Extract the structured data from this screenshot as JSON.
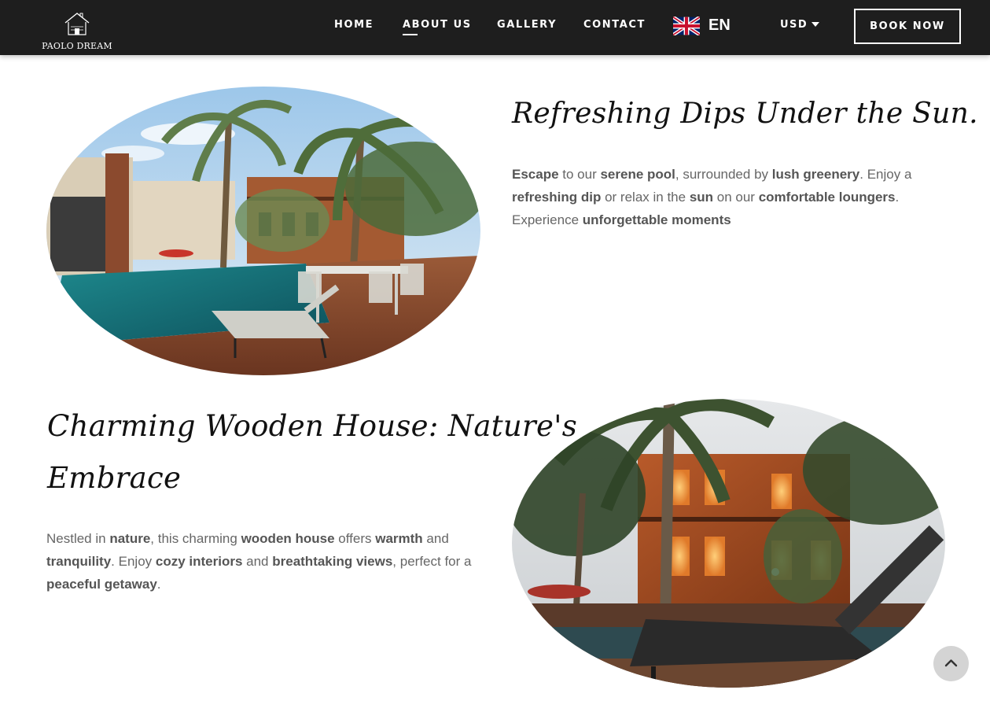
{
  "header": {
    "logo_text": "PAOLO DREAM",
    "nav": [
      {
        "label": "HOME"
      },
      {
        "label": "ABOUT US",
        "active": true
      },
      {
        "label": "GALLERY"
      },
      {
        "label": "CONTACT"
      }
    ],
    "language": {
      "label": "EN",
      "flag_icon": "uk-flag-icon"
    },
    "currency": {
      "label": "USD",
      "icon": "caret-down-icon"
    },
    "book_button": "BOOK NOW"
  },
  "section_pool": {
    "title": "Refreshing Dips Under the Sun.",
    "text": [
      {
        "t": "Escape",
        "b": true
      },
      {
        "t": " to our ",
        "b": false
      },
      {
        "t": "serene pool",
        "b": true
      },
      {
        "t": ", surrounded by ",
        "b": false
      },
      {
        "t": "lush greenery",
        "b": true
      },
      {
        "t": ". Enjoy a ",
        "b": false
      },
      {
        "t": "refreshing dip",
        "b": true
      },
      {
        "t": " or relax in the ",
        "b": false
      },
      {
        "t": "sun",
        "b": true
      },
      {
        "t": " on our ",
        "b": false
      },
      {
        "t": "comfortable loungers",
        "b": true
      },
      {
        "t": ". Experience ",
        "b": false
      },
      {
        "t": "unforgettable moments",
        "b": true
      }
    ]
  },
  "section_house": {
    "title_line1": "Charming Wooden House: Nature's",
    "title_line2": "Embrace",
    "text": [
      {
        "t": "Nestled in ",
        "b": false
      },
      {
        "t": "nature",
        "b": true
      },
      {
        "t": ", this charming ",
        "b": false
      },
      {
        "t": "wooden house",
        "b": true
      },
      {
        "t": " offers ",
        "b": false
      },
      {
        "t": "warmth",
        "b": true
      },
      {
        "t": " and ",
        "b": false
      },
      {
        "t": "tranquility",
        "b": true
      },
      {
        "t": ". Enjoy ",
        "b": false
      },
      {
        "t": "cozy interiors",
        "b": true
      },
      {
        "t": " and ",
        "b": false
      },
      {
        "t": "breathtaking views",
        "b": true
      },
      {
        "t": ", perfect for a ",
        "b": false
      },
      {
        "t": "peaceful getaway",
        "b": true
      },
      {
        "t": ".",
        "b": false
      }
    ]
  },
  "scroll_top_icon": "chevron-up-icon",
  "colors": {
    "header_bg": "#1e1e1e",
    "text": "#666666",
    "accent": "#ffffff"
  }
}
